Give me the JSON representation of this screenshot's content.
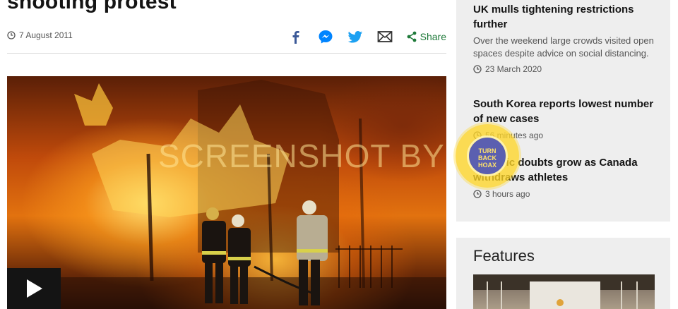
{
  "article": {
    "headline": "shooting protest",
    "date": "7 August 2011",
    "share_label": "Share",
    "share_icons": [
      "facebook-icon",
      "messenger-icon",
      "twitter-icon",
      "email-icon",
      "share-icon"
    ]
  },
  "hero": {
    "watermark": "SCREENSHOT BY"
  },
  "sidebar": {
    "stories": [
      {
        "title": "UK mulls tightening restrictions further",
        "summary": "Over the weekend large crowds visited open spaces despite advice on social distancing.",
        "time": "23 March 2020"
      },
      {
        "title": "South Korea reports lowest number of new cases",
        "summary": "",
        "time": "56 minutes ago"
      },
      {
        "title": "Olympic doubts grow as Canada withdraws athletes",
        "summary": "",
        "time": "3 hours ago"
      }
    ]
  },
  "features": {
    "title": "Features"
  },
  "seal": {
    "text": "TURN BACK HOAX"
  },
  "colors": {
    "facebook": "#3b5998",
    "messenger": "#0084ff",
    "twitter": "#1da1f2",
    "share_green": "#1f7a3a",
    "sidebar_bg": "#eeeeee"
  }
}
